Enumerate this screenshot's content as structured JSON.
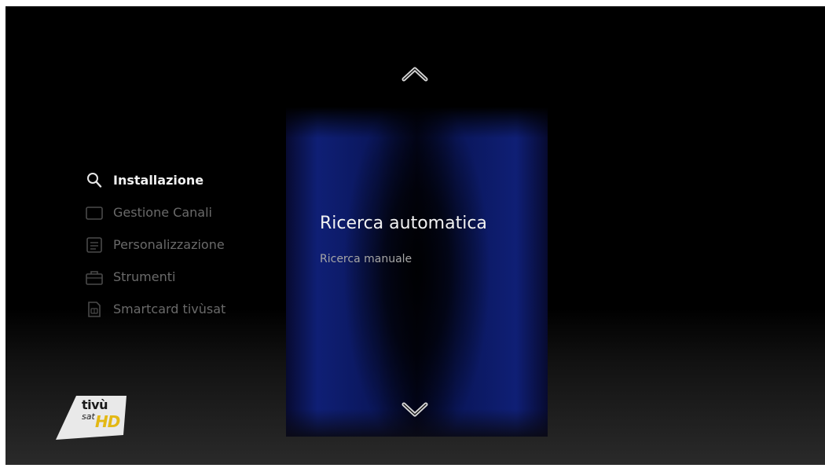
{
  "menu": {
    "items": [
      {
        "label": "Installazione",
        "icon": "search-icon",
        "active": true
      },
      {
        "label": "Gestione Canali",
        "icon": "tv-screen-icon",
        "active": false
      },
      {
        "label": "Personalizzazione",
        "icon": "list-icon",
        "active": false
      },
      {
        "label": "Strumenti",
        "icon": "toolbox-icon",
        "active": false
      },
      {
        "label": "Smartcard tivùsat",
        "icon": "smartcard-icon",
        "active": false
      }
    ]
  },
  "submenu": {
    "selected": "Ricerca automatica",
    "items": [
      "Ricerca automatica",
      "Ricerca manuale"
    ]
  },
  "navigation": {
    "up_icon": "chevron-up-icon",
    "down_icon": "chevron-down-icon"
  },
  "logo": {
    "line1": "tivù",
    "line2": "sat",
    "badge": "HD"
  },
  "colors": {
    "panel_blue": "#0f1f75",
    "active_text": "#f0f0f0",
    "inactive_text": "#6a6a6a",
    "logo_gold": "#e3b814"
  }
}
